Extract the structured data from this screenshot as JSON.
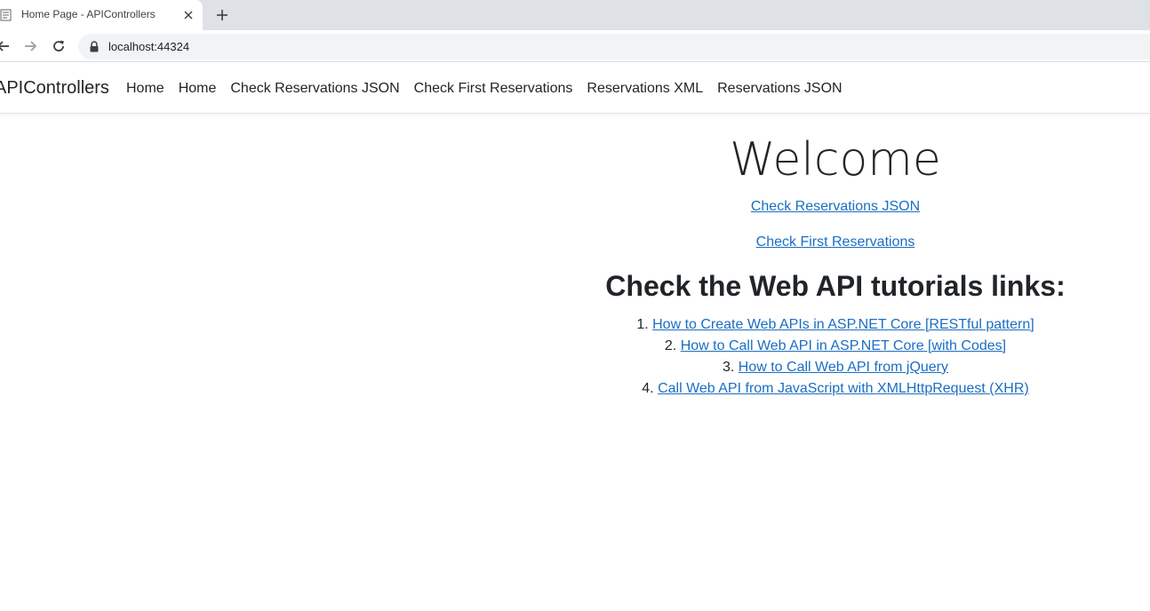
{
  "browser": {
    "tab_title": "Home Page - APIControllers",
    "url": "localhost:44324",
    "icons": {
      "favicon": "page-icon",
      "close": "close-icon",
      "new_tab": "plus-icon",
      "back": "arrow-left-icon",
      "forward": "arrow-right-icon",
      "reload": "reload-icon",
      "lock": "lock-icon"
    }
  },
  "navbar": {
    "brand": "APIControllers",
    "links": [
      "Home",
      "Home",
      "Check Reservations JSON",
      "Check First Reservations",
      "Reservations XML",
      "Reservations JSON"
    ]
  },
  "main": {
    "title": "Welcome",
    "links": [
      "Check Reservations JSON",
      "Check First Reservations"
    ],
    "tutorials_heading": "Check the Web API tutorials links:",
    "tutorials": [
      {
        "num": "1.",
        "label": "How to Create Web APIs in ASP.NET Core [RESTful pattern]"
      },
      {
        "num": "2.",
        "label": "How to Call Web API in ASP.NET Core [with Codes]"
      },
      {
        "num": "3.",
        "label": "How to Call Web API from jQuery"
      },
      {
        "num": "4.",
        "label": "Call Web API from JavaScript with XMLHttpRequest (XHR)"
      }
    ]
  },
  "colors": {
    "link": "#1b6ec2",
    "text": "#212529",
    "tabstrip": "#dee1e6",
    "omnibox": "#f1f3f4"
  }
}
